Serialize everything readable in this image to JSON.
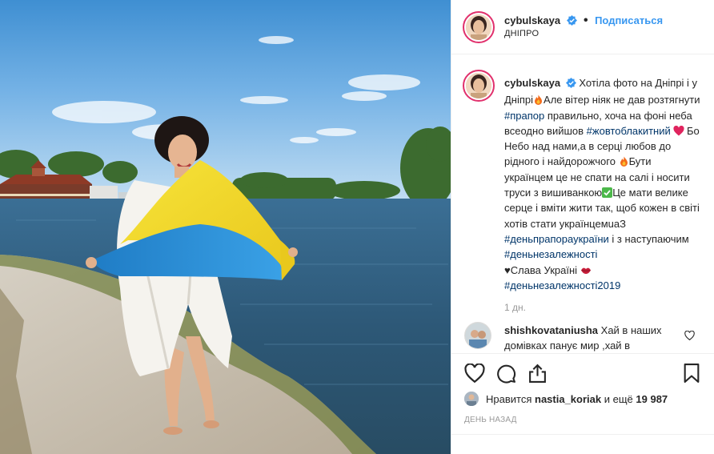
{
  "header": {
    "username": "cybulskaya",
    "follow_label": "Подписаться",
    "dot": "•",
    "location": "ДНІПРО"
  },
  "caption": {
    "username": "cybulskaya",
    "t1": "Хотіла фото на Дніпрі і у Дніпрі",
    "t2": "Але вітер ніяк не дав розтягнути ",
    "tag1": "#прапор",
    "t3": " правильно, хоча на фоні неба всеодно вийшов ",
    "tag2": "#жовтоблакитний",
    "t4": " Бо Небо над нами,а в серці любов до рідного і найдорожчого ",
    "t5": "Бути українцем це не спати на салі і носити труси з вишиванкою",
    "t6": "Це мати велике серце і вміти жити так, щоб кожен в світі хотів стати українцемuaЗ ",
    "tag3": "#деньпрапораукраїни",
    "t7": " і з наступаючим ",
    "tag4": "#деньнезалежності",
    "t8": "♥Слава Україні ",
    "tag5": "#деньнезалежності2019"
  },
  "age": "1 дн.",
  "comment": {
    "username": "shishkovataniusha",
    "text": " Хай в наших домівках панує мир ,хай в"
  },
  "likes": {
    "prefix": "Нравится ",
    "user": "nastia_koriak",
    "middle": " и ещё ",
    "count": "19 987"
  },
  "date": "ДЕНЬ НАЗАД",
  "icons": {
    "like": "heart-icon",
    "comment": "comment-icon",
    "share": "share-icon",
    "save": "bookmark-icon",
    "verified": "verified-badge-icon"
  },
  "colors": {
    "accent": "#3897f0",
    "hashtag": "#003569",
    "flag_blue": "#2f8fd6",
    "flag_yellow": "#f4e022"
  }
}
